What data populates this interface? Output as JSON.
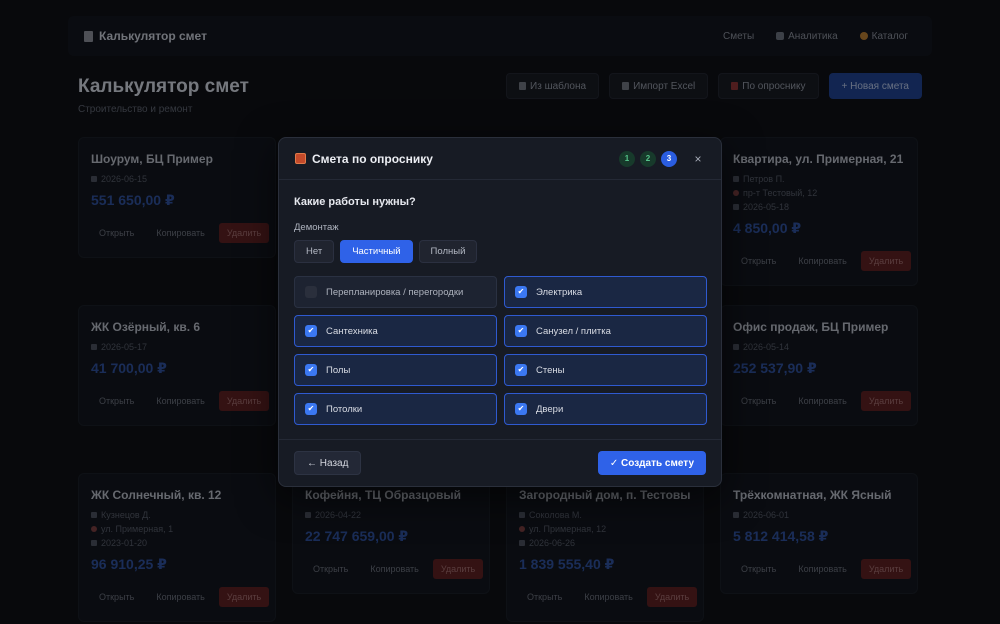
{
  "topbar": {
    "brand": "Калькулятор смет",
    "nav": [
      "Сметы",
      "Аналитика",
      "Каталог"
    ]
  },
  "page": {
    "title": "Калькулятор смет",
    "subtitle": "Строительство и ремонт",
    "actions": [
      "Из шаблона",
      "Импорт Excel",
      "По опроснику",
      "+ Новая смета"
    ]
  },
  "card_actions": {
    "open": "Открыть",
    "copy": "Копировать",
    "delete": "Удалить"
  },
  "cards": [
    {
      "title": "Шоурум, БЦ Пример",
      "meta": [
        "2026-06-15"
      ],
      "amount": "551 650,00 ₽"
    },
    {
      "title": "Квартира, ул. Примерная, 21",
      "meta": [
        "Петров П.",
        "пр-т Тестовый, 12",
        "2026-05-18"
      ],
      "amount": "4 850,00 ₽"
    },
    {
      "title": "ЖК Озёрный, кв. 6",
      "meta": [
        "2026-05-17"
      ],
      "amount": "41 700,00 ₽"
    },
    {
      "title": "Офис продаж, БЦ Пример",
      "meta": [
        "2026-05-14"
      ],
      "amount": "252 537,90 ₽"
    },
    {
      "title": "ЖК Солнечный, кв. 12",
      "meta": [
        "Кузнецов Д.",
        "ул. Примерная, 1",
        "2023-01-20"
      ],
      "amount": "96 910,25 ₽"
    },
    {
      "title": "Кофейня, ТЦ Образцовый",
      "meta": [
        "2026-04-22"
      ],
      "amount": "22 747 659,00 ₽"
    },
    {
      "title": "Загородный дом, п. Тестовый",
      "meta": [
        "Соколова М.",
        "ул. Примерная, 12",
        "2026-06-26"
      ],
      "amount": "1 839 555,40 ₽"
    },
    {
      "title": "Трёхкомнатная, ЖК Ясный",
      "meta": [
        "2026-06-01"
      ],
      "amount": "5 812 414,58 ₽"
    }
  ],
  "modal": {
    "title": "Смета по опроснику",
    "steps": [
      "1",
      "2",
      "3"
    ],
    "active_step": 3,
    "close": "×",
    "question": "Какие работы нужны?",
    "group_label": "Демонтаж",
    "segments": [
      "Нет",
      "Частичный",
      "Полный"
    ],
    "selected_segment": "Частичный",
    "options": [
      {
        "label": "Перепланировка / перегородки",
        "checked": false
      },
      {
        "label": "Электрика",
        "checked": true
      },
      {
        "label": "Сантехника",
        "checked": true
      },
      {
        "label": "Санузел / плитка",
        "checked": true
      },
      {
        "label": "Полы",
        "checked": true
      },
      {
        "label": "Стены",
        "checked": true
      },
      {
        "label": "Потолки",
        "checked": true
      },
      {
        "label": "Двери",
        "checked": true
      }
    ],
    "back_label": "← Назад",
    "create_label": "✓ Создать смету"
  },
  "colors": {
    "accent": "#2f62e8",
    "checkbox": "#3b78f2",
    "step_done": "#55c48a",
    "danger": "#5c1c1c"
  }
}
